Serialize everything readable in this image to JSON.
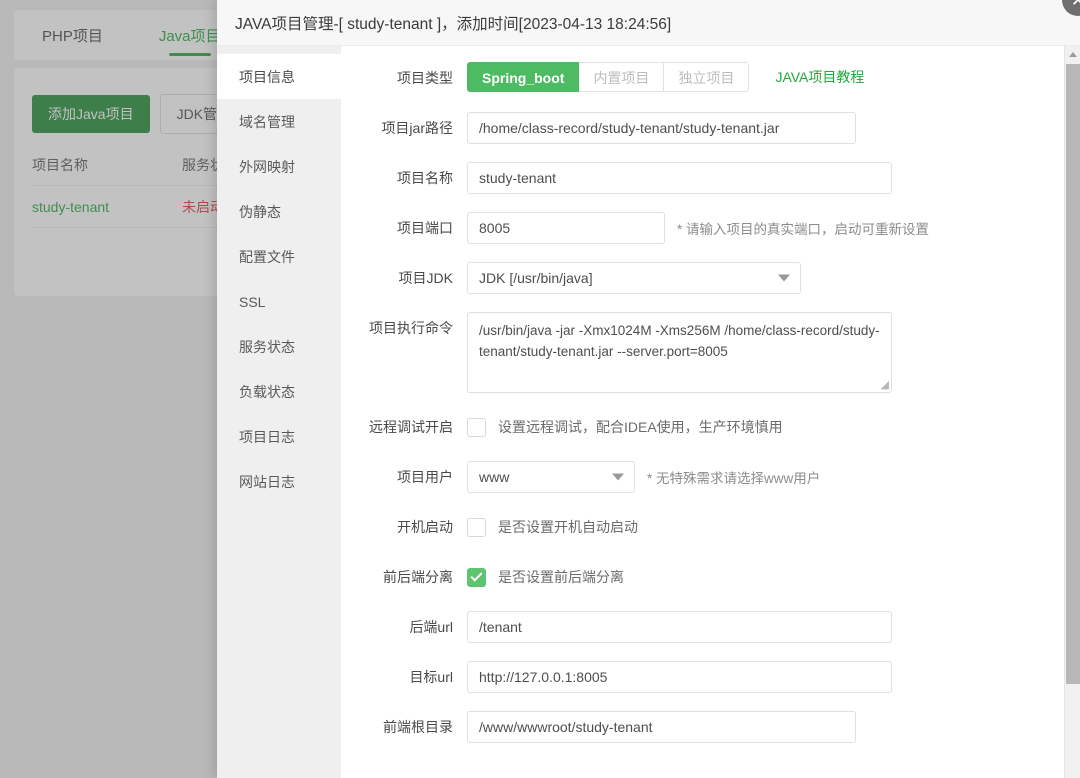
{
  "background": {
    "tabs": [
      {
        "label": "PHP项目",
        "active": false
      },
      {
        "label": "Java项目",
        "active": true
      }
    ],
    "toolbar": {
      "add_button": "添加Java项目",
      "jdk_button": "JDK管理"
    },
    "table": {
      "headers": [
        "项目名称",
        "服务状态"
      ],
      "rows": [
        {
          "name": "study-tenant",
          "status": "未启动"
        }
      ]
    }
  },
  "modal": {
    "title": "JAVA项目管理-[ study-tenant ]，添加时间[2023-04-13 18:24:56]",
    "close_icon": "close-icon",
    "sidebar": [
      {
        "label": "项目信息",
        "active": true
      },
      {
        "label": "域名管理",
        "active": false
      },
      {
        "label": "外网映射",
        "active": false
      },
      {
        "label": "伪静态",
        "active": false
      },
      {
        "label": "配置文件",
        "active": false
      },
      {
        "label": "SSL",
        "active": false
      },
      {
        "label": "服务状态",
        "active": false
      },
      {
        "label": "负载状态",
        "active": false
      },
      {
        "label": "项目日志",
        "active": false
      },
      {
        "label": "网站日志",
        "active": false
      }
    ],
    "form": {
      "project_type": {
        "label": "项目类型",
        "options": [
          {
            "label": "Spring_boot",
            "active": true
          },
          {
            "label": "内置项目",
            "active": false
          },
          {
            "label": "独立项目",
            "active": false
          }
        ],
        "tutorial_link": "JAVA项目教程"
      },
      "jar_path": {
        "label": "项目jar路径",
        "value": "/home/class-record/study-tenant/study-tenant.jar"
      },
      "project_name": {
        "label": "项目名称",
        "value": "study-tenant"
      },
      "project_port": {
        "label": "项目端口",
        "value": "8005",
        "hint": "* 请输入项目的真实端口，启动可重新设置"
      },
      "project_jdk": {
        "label": "项目JDK",
        "value": "JDK [/usr/bin/java]"
      },
      "exec_command": {
        "label": "项目执行命令",
        "value": "/usr/bin/java -jar -Xmx1024M -Xms256M  /home/class-record/study-tenant/study-tenant.jar --server.port=8005"
      },
      "remote_debug": {
        "label": "远程调试开启",
        "checkbox_label": "设置远程调试，配合IDEA使用，生产环境慎用",
        "checked": false
      },
      "project_user": {
        "label": "项目用户",
        "value": "www",
        "hint": "* 无特殊需求请选择www用户"
      },
      "boot_start": {
        "label": "开机启动",
        "checkbox_label": "是否设置开机自动启动",
        "checked": false
      },
      "split_fe_be": {
        "label": "前后端分离",
        "checkbox_label": "是否设置前后端分离",
        "checked": true
      },
      "backend_url": {
        "label": "后端url",
        "value": "/tenant"
      },
      "target_url": {
        "label": "目标url",
        "value": "http://127.0.0.1:8005"
      },
      "frontend_root": {
        "label": "前端根目录",
        "value": "/www/wwwroot/study-tenant"
      }
    }
  },
  "colors": {
    "brand_green": "#20a53a",
    "active_seg": "#4cbb62",
    "status_red": "#e03434",
    "checkbox_green": "#5ec46f"
  }
}
